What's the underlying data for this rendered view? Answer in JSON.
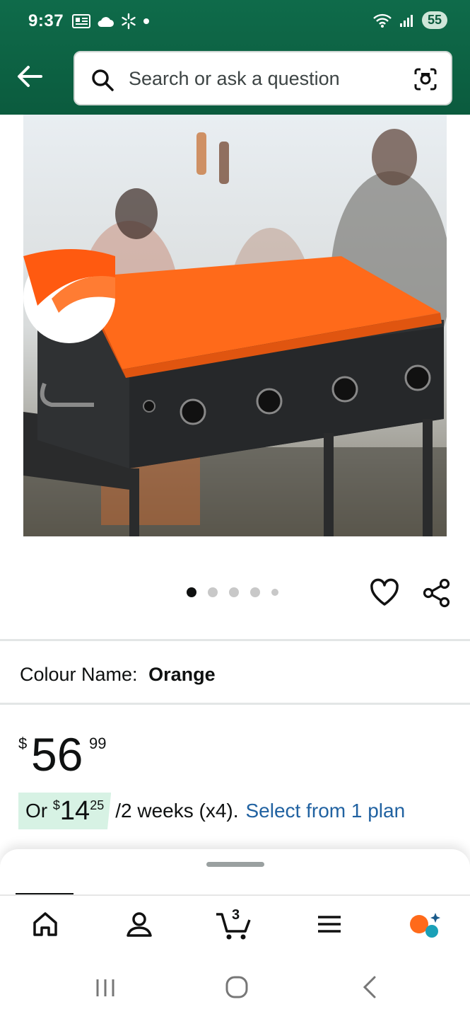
{
  "status_bar": {
    "time": "9:37",
    "battery": "55"
  },
  "search": {
    "placeholder": "Search or ask a question"
  },
  "carousel": {
    "dot_count": 5,
    "active_index": 0
  },
  "colour": {
    "label": "Colour Name:",
    "value": "Orange"
  },
  "price": {
    "currency": "$",
    "whole": "56",
    "fraction": "99"
  },
  "installment": {
    "prefix": "Or",
    "currency": "$",
    "whole": "14",
    "fraction": "25",
    "terms": "/2 weeks (x4).",
    "link": "Select from 1 plan"
  },
  "cart": {
    "count": "3"
  },
  "colors": {
    "header_green": "#0b5b3e",
    "link_blue": "#2162a1",
    "griddle_orange": "#ff6a1a"
  }
}
